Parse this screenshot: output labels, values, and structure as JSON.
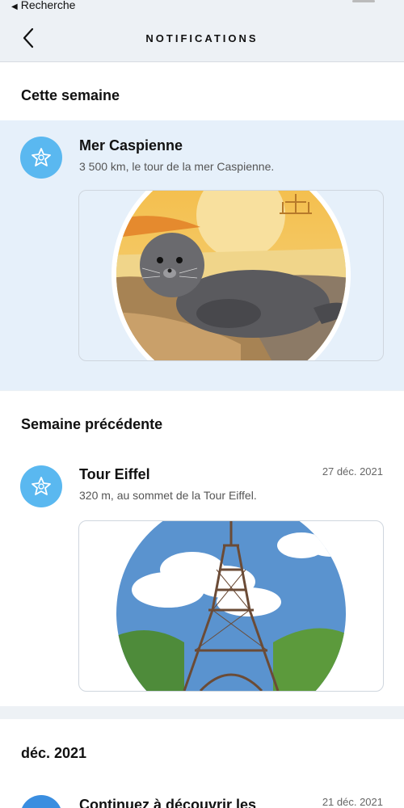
{
  "status": {
    "back_app_label": "Recherche"
  },
  "header": {
    "title": "NOTIFICATIONS"
  },
  "sections": [
    {
      "title": "Cette semaine",
      "items": [
        {
          "title": "Mer Caspienne",
          "subtitle": "3 500 km, le tour de la mer Caspienne.",
          "date": "",
          "badge_color": "#5ab8f0",
          "image": "caspian-seal-illustration"
        }
      ]
    },
    {
      "title": "Semaine précédente",
      "items": [
        {
          "title": "Tour Eiffel",
          "subtitle": "320 m, au sommet de la Tour Eiffel.",
          "date": "27 déc. 2021",
          "badge_color": "#5ab8f0",
          "image": "eiffel-tower-illustration"
        }
      ]
    },
    {
      "title": "déc. 2021",
      "items": [
        {
          "title": "Continuez à découvrir les",
          "date": "21 déc. 2021",
          "badge_color": "#3a8ee0"
        }
      ]
    }
  ],
  "colors": {
    "page_bg": "#edf1f5",
    "highlight_bg": "#e6f0fa",
    "accent": "#5ab8f0"
  }
}
